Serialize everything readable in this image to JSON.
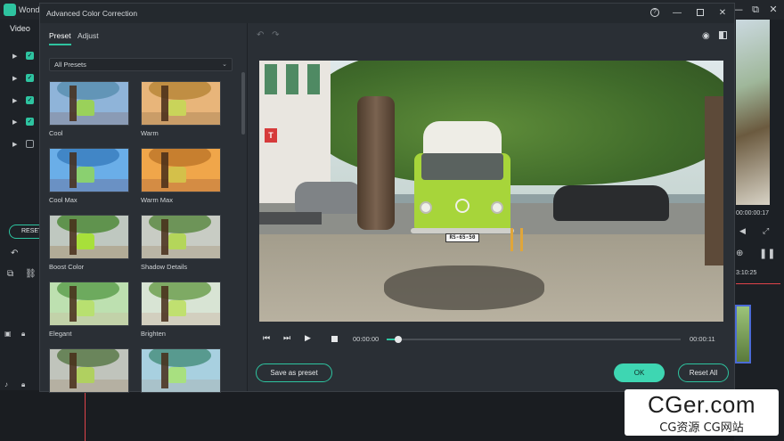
{
  "app": {
    "title": "Wond",
    "tab_video": "Video",
    "reset_label": "RESET",
    "right_time_top": "00:00:00:17",
    "right_time_ruler": "3:10:25",
    "window_minimize": "—",
    "window_restore": "⧉",
    "window_close": "✕"
  },
  "dialog": {
    "title": "Advanced Color Correction",
    "help": "?",
    "minimize": "—",
    "close": "✕",
    "tabs": [
      {
        "label": "Preset",
        "active": true
      },
      {
        "label": "Adjust",
        "active": false
      }
    ],
    "preset_filter": {
      "value": "All Presets",
      "chevron": "⌄"
    },
    "presets": [
      {
        "label": "Cool",
        "sky": "#8fb4d9",
        "canopy": "#5a8fb0",
        "van": "#9ad15a",
        "ground": "#8a98b0"
      },
      {
        "label": "Warm",
        "sky": "#e8b57a",
        "canopy": "#b8873a",
        "van": "#c9d45a",
        "ground": "#c79a66"
      },
      {
        "label": "Cool Max",
        "sky": "#6aaee8",
        "canopy": "#3a7fc0",
        "van": "#8ad070",
        "ground": "#6a8ec0"
      },
      {
        "label": "Warm Max",
        "sky": "#f0a64a",
        "canopy": "#c0782a",
        "van": "#d4c04a",
        "ground": "#d08a44"
      },
      {
        "label": "Boost Color",
        "sky": "#bfc8c0",
        "canopy": "#4f8a3a",
        "van": "#a8e03a",
        "ground": "#b0a892"
      },
      {
        "label": "Shadow Details",
        "sky": "#c8ccc4",
        "canopy": "#5d8a45",
        "van": "#b4d65a",
        "ground": "#b8b2a2"
      },
      {
        "label": "Elegant",
        "sky": "#bde0b0",
        "canopy": "#5fa050",
        "van": "#b8e070",
        "ground": "#c2d0a8"
      },
      {
        "label": "Brighten",
        "sky": "#d8e4d4",
        "canopy": "#6fa050",
        "van": "#c0e070",
        "ground": "#d2ccbc"
      },
      {
        "label": "",
        "sky": "#c0c4bc",
        "canopy": "#5a7a4a",
        "van": "#b0d060",
        "ground": "#b4ae9e"
      },
      {
        "label": "",
        "sky": "#a8d0e0",
        "canopy": "#4a9080",
        "van": "#a8e080",
        "ground": "#a8c0c8"
      }
    ],
    "undo_icon": "↶",
    "redo_icon": "↷",
    "eye_icon": "◉",
    "viewer": {
      "plate": "RS-65-50",
      "sign": "T"
    },
    "transport": {
      "prev_icon": "⏮",
      "step_icon": "⏭",
      "play_icon": "▶",
      "current_time": "00:00:00",
      "total_time": "00:00:11",
      "progress": 0.04
    },
    "buttons": {
      "save_preset": "Save as preset",
      "ok": "OK",
      "reset_all": "Reset All"
    }
  },
  "watermark": {
    "main": "CGer.com",
    "sub": "CG资源  CG网站"
  },
  "colors": {
    "accent": "#2ec4a0",
    "ok_fill": "#3ed6b2",
    "dialog_bg": "#2a2f35",
    "playhead": "#e0434a"
  }
}
